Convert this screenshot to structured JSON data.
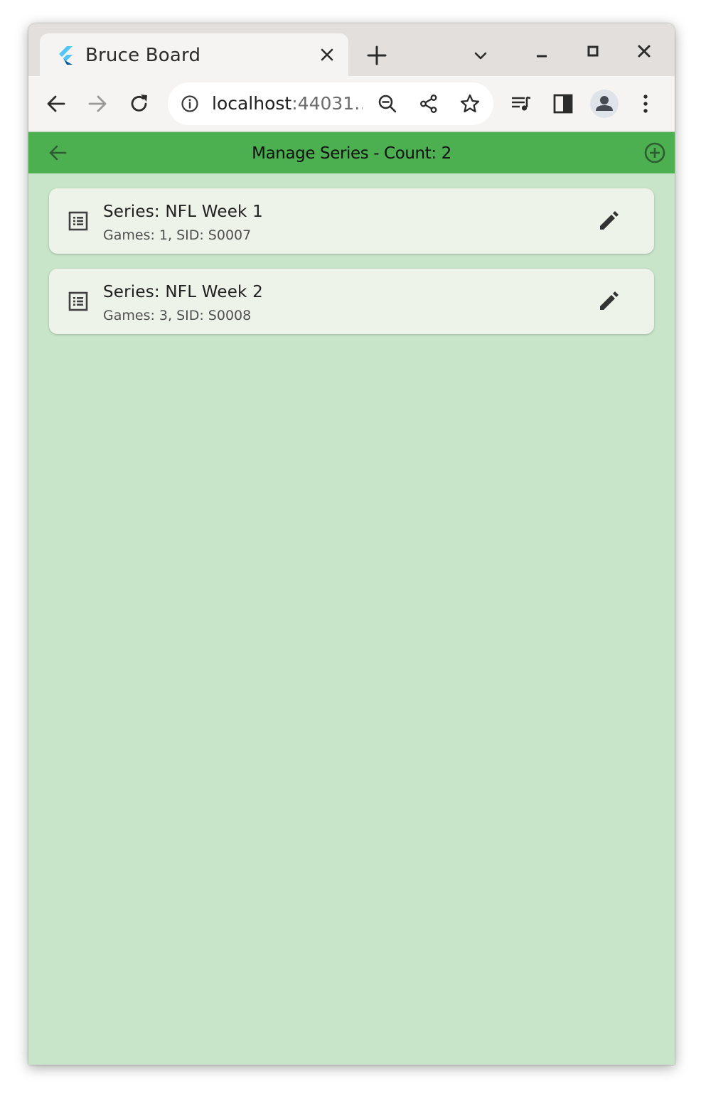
{
  "browser": {
    "tab": {
      "title": "Bruce Board",
      "favicon": "flutter-logo-icon"
    },
    "toolbar": {
      "url_host": "localhost",
      "url_port_truncated": ":44031…",
      "icons": [
        "back-arrow-icon",
        "forward-arrow-icon",
        "reload-icon",
        "info-icon",
        "zoom-out-icon",
        "share-icon",
        "star-icon",
        "media-queue-icon",
        "side-panel-icon",
        "profile-icon",
        "menu-kebab-icon"
      ]
    }
  },
  "appbar": {
    "title": "Manage Series - Count: 2",
    "color": "#4caf50"
  },
  "series": [
    {
      "title": "Series: NFL Week 1",
      "subtitle": "Games: 1, SID: S0007"
    },
    {
      "title": "Series: NFL Week 2",
      "subtitle": "Games: 3, SID: S0008"
    }
  ],
  "colors": {
    "background": "#c8e5c9",
    "card": "#eef3ea"
  }
}
